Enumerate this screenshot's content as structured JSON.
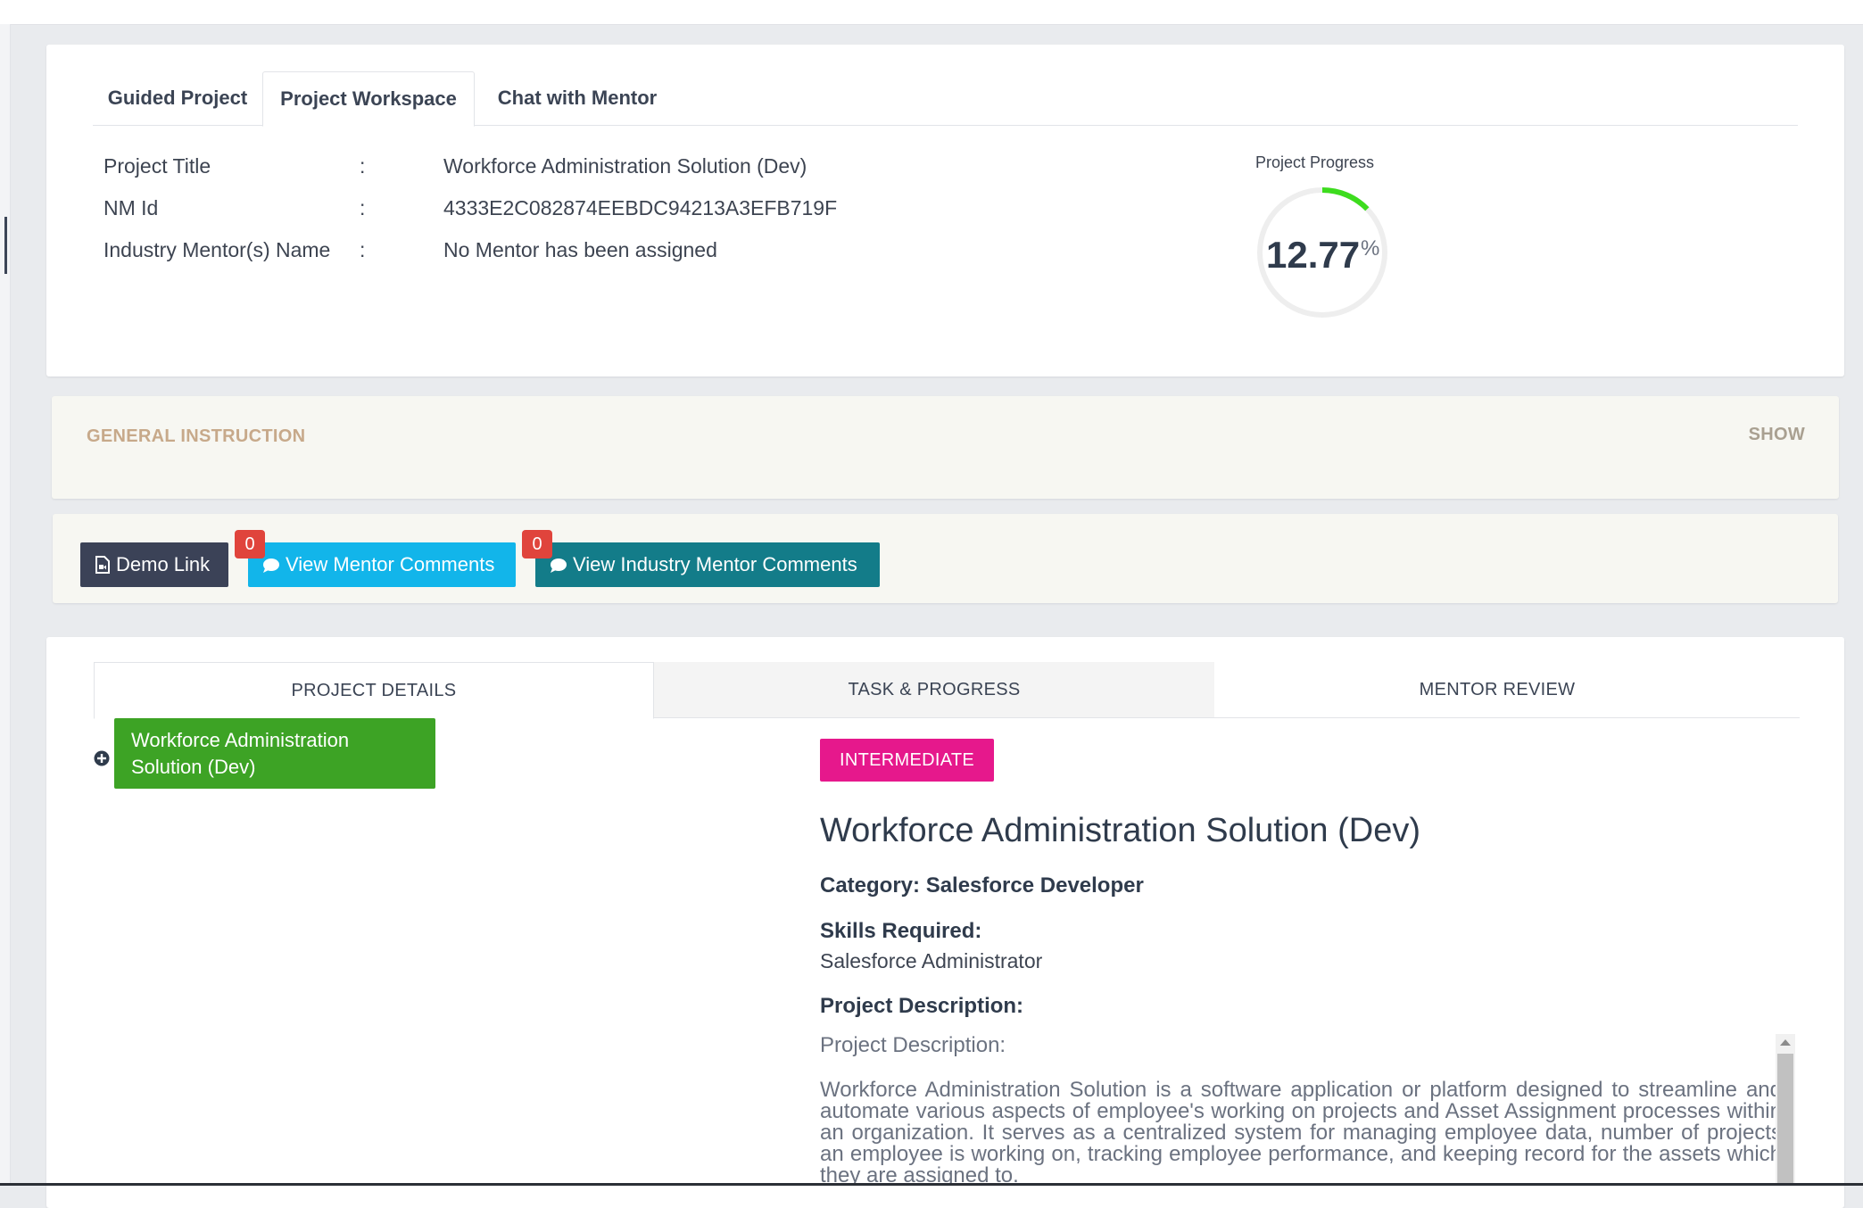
{
  "tabs": [
    "Guided Project",
    "Project Workspace",
    "Chat with Mentor"
  ],
  "active_tab": "Project Workspace",
  "info": {
    "title_label": "Project Title",
    "title_value": "Workforce Administration Solution (Dev)",
    "nmid_label": "NM Id",
    "nmid_value": "4333E2C082874EEBDC94213A3EFB719F",
    "mentor_label": "Industry Mentor(s) Name",
    "mentor_value": "No Mentor has been assigned",
    "colon": ":"
  },
  "progress": {
    "label": "Project Progress",
    "value": "12.77",
    "unit": "%",
    "fraction": 0.1277,
    "color": "#3ddc1e"
  },
  "instruction": {
    "title": "GENERAL INSTRUCTION",
    "toggle": "SHOW"
  },
  "actions": {
    "demo_label": "Demo Link",
    "mentor_comments_label": "View Mentor Comments",
    "mentor_comments_count": "0",
    "industry_comments_label": "View Industry Mentor Comments",
    "industry_comments_count": "0"
  },
  "details_tabs": [
    "PROJECT DETAILS",
    "TASK & PROGRESS",
    "MENTOR REVIEW"
  ],
  "tree": {
    "node_label": "Workforce Administration Solution (Dev)"
  },
  "details": {
    "level": "INTERMEDIATE",
    "heading": "Workforce Administration Solution (Dev)",
    "category": "Category: Salesforce Developer",
    "skills_label": "Skills Required:",
    "skills_value": "Salesforce Administrator",
    "description_label": "Project Description:",
    "description_sub": "Project Description:",
    "description_text": "Workforce Administration Solution is a software application or platform designed to streamline and automate various aspects of employee's working on projects and Asset Assignment processes within an organization. It serves as a centralized system for managing employee data, number of projects an employee is working on, tracking employee performance, and keeping record for the assets which they are assigned to."
  },
  "colors": {
    "demo_button": "#3b4257",
    "mentor_button": "#12b5ea",
    "industry_button": "#137c89",
    "badge": "#e0443c",
    "tree_node": "#3da325",
    "level_badge": "#e6188c"
  }
}
